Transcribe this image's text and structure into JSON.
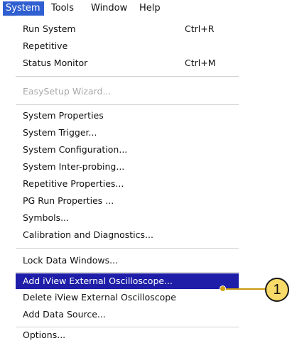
{
  "menubar": {
    "items": [
      {
        "label": "System",
        "active": true
      },
      {
        "label": "Tools",
        "active": false
      },
      {
        "label": "Window",
        "active": false
      },
      {
        "label": "Help",
        "active": false
      }
    ]
  },
  "menu": {
    "items": [
      {
        "label": "Run System",
        "shortcut": "Ctrl+R"
      },
      {
        "label": "Repetitive",
        "shortcut": ""
      },
      {
        "label": "Status Monitor",
        "shortcut": "Ctrl+M"
      },
      {
        "label": "EasySetup Wizard...",
        "disabled": true
      },
      {
        "label": "System Properties"
      },
      {
        "label": "System Trigger..."
      },
      {
        "label": "System Configuration..."
      },
      {
        "label": "System Inter-probing..."
      },
      {
        "label": "Repetitive Properties..."
      },
      {
        "label": "PG Run Properties ..."
      },
      {
        "label": "Symbols..."
      },
      {
        "label": "Calibration and Diagnostics..."
      },
      {
        "label": "Lock Data Windows..."
      },
      {
        "label": "Add iView External Oscilloscope...",
        "selected": true
      },
      {
        "label": "Delete iView External Oscilloscope"
      },
      {
        "label": "Add Data Source..."
      },
      {
        "label": "Options..."
      }
    ]
  },
  "callout": {
    "number": "1"
  },
  "colors": {
    "menubar_active": "#2f5fd0",
    "selected_item": "#1e1ea8",
    "callout_fill": "#f7da68",
    "callout_line": "#c89a10"
  }
}
